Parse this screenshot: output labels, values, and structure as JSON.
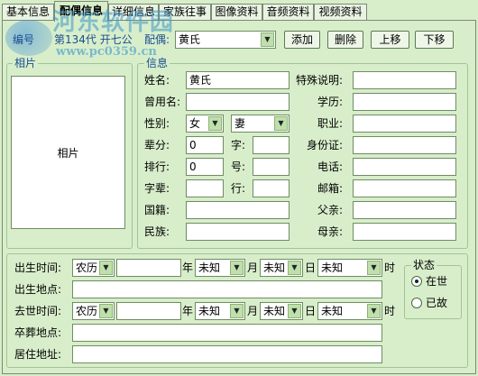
{
  "tabs": [
    {
      "label": "基本信息"
    },
    {
      "label": "配偶信息"
    },
    {
      "label": "详细信息"
    },
    {
      "label": "家族往事"
    },
    {
      "label": "图像资料"
    },
    {
      "label": "音频资料"
    },
    {
      "label": "视频资料"
    }
  ],
  "toolbar": {
    "code_label": "编号",
    "generation_text": "第134代 开七公",
    "spouse_label": "配偶:",
    "spouse_value": "黄氏",
    "add": "添加",
    "delete": "删除",
    "move_up": "上移",
    "move_down": "下移"
  },
  "photo": {
    "group_title": "相片",
    "placeholder": "相片"
  },
  "info": {
    "group_title": "信息",
    "name_label": "姓名:",
    "name_value": "黄氏",
    "special_label": "特殊说明:",
    "special_value": "",
    "alias_label": "曾用名:",
    "alias_value": "",
    "education_label": "学历:",
    "education_value": "",
    "gender_label": "性别:",
    "gender_value": "女",
    "relation_value": "妻",
    "job_label": "职业:",
    "job_value": "",
    "generation_label": "辈分:",
    "generation_value": "0",
    "zi_label": "字:",
    "zi_value": "",
    "id_label": "身份证:",
    "id_value": "",
    "rank_label": "排行:",
    "rank_value": "0",
    "hao_label": "号:",
    "hao_value": "",
    "phone_label": "电话:",
    "phone_value": "",
    "zibei_label": "字辈:",
    "zibei_value": "",
    "hang_label": "行:",
    "hang_value": "",
    "email_label": "邮箱:",
    "email_value": "",
    "nationality_label": "国籍:",
    "nationality_value": "",
    "father_label": "父亲:",
    "father_value": "",
    "ethnicity_label": "民族:",
    "ethnicity_value": "",
    "mother_label": "母亲:",
    "mother_value": ""
  },
  "life": {
    "birth_time_label": "出生时间:",
    "birth_calendar": "农历",
    "birth_year": "",
    "year_unit": "年",
    "birth_month": "未知",
    "month_unit": "月",
    "birth_day": "未知",
    "day_unit": "日",
    "birth_hour": "未知",
    "hour_unit": "时",
    "birth_place_label": "出生地点:",
    "birth_place_value": "",
    "death_time_label": "去世时间:",
    "death_calendar": "农历",
    "death_year": "",
    "death_month": "未知",
    "death_day": "未知",
    "death_hour": "未知",
    "burial_label": "卒葬地点:",
    "burial_value": "",
    "residence_label": "居住地址:",
    "residence_value": ""
  },
  "status": {
    "group_title": "状态",
    "alive": "在世",
    "deceased": "已故",
    "selected": "alive"
  },
  "watermark": {
    "title": "河东软件园",
    "url": "www.pc0359.cn"
  }
}
